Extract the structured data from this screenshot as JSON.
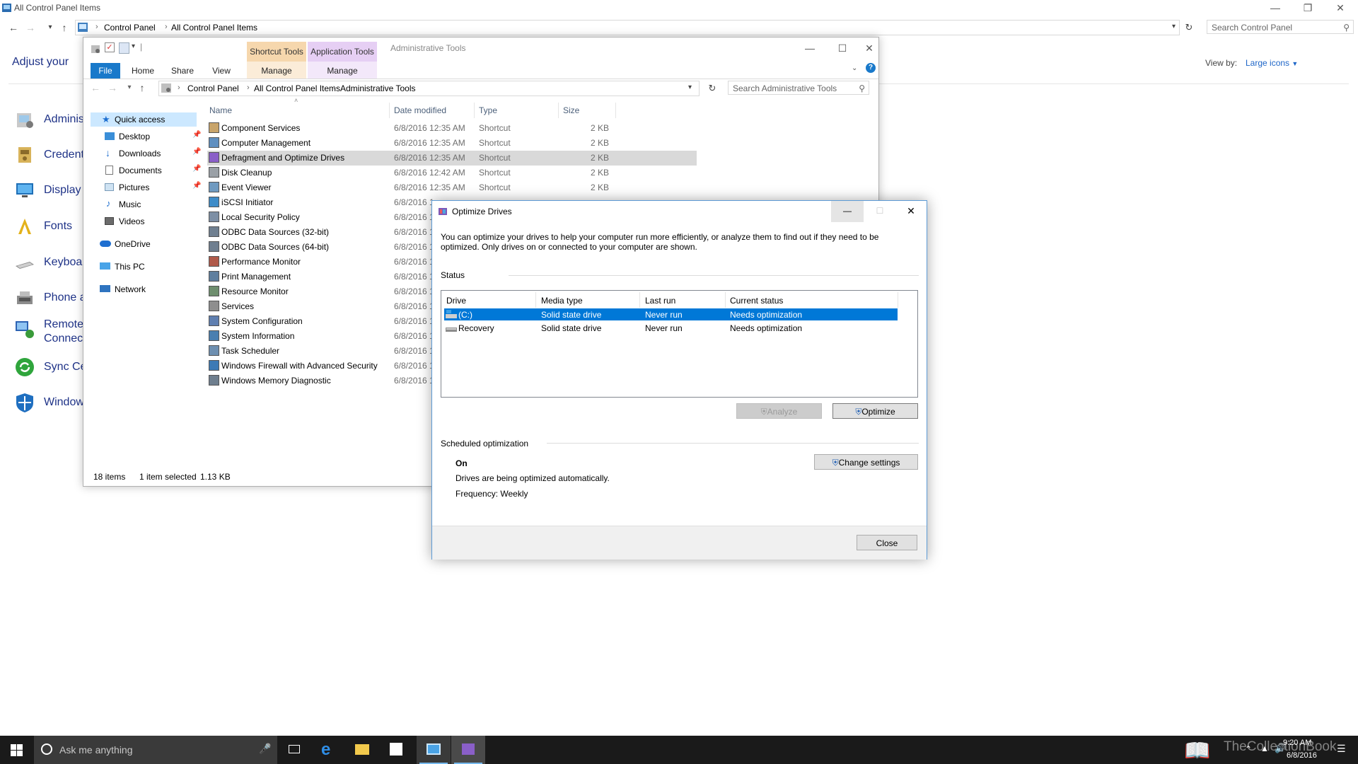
{
  "control_panel": {
    "title": "All Control Panel Items",
    "breadcrumb": [
      "Control Panel",
      "All Control Panel Items"
    ],
    "search_placeholder": "Search Control Panel",
    "adjust_text": "Adjust your co",
    "view_by_label": "View by:",
    "view_by_value": "Large icons",
    "items": [
      {
        "label": "Adminis",
        "icon": "admin-tools-icon"
      },
      {
        "label": "Credent",
        "icon": "credential-manager-icon"
      },
      {
        "label": "Display",
        "icon": "display-icon"
      },
      {
        "label": "Fonts",
        "icon": "fonts-icon"
      },
      {
        "label": "Keyboar",
        "icon": "keyboard-icon"
      },
      {
        "label": "Phone a",
        "icon": "phone-modem-icon"
      },
      {
        "label": "Remote",
        "label2": "Connect",
        "icon": "remote-connections-icon"
      },
      {
        "label": "Sync Ce",
        "icon": "sync-center-icon"
      },
      {
        "label": "Window",
        "icon": "windows-defender-icon"
      }
    ]
  },
  "explorer": {
    "title": "Administrative Tools",
    "context_tabs": [
      {
        "head": "Shortcut Tools",
        "tab": "Manage",
        "color": "#f5d9b0"
      },
      {
        "head": "Application Tools",
        "tab": "Manage",
        "color": "#e3cbf0"
      }
    ],
    "ribbon_tabs": {
      "file": "File",
      "home": "Home",
      "share": "Share",
      "view": "View"
    },
    "breadcrumb": [
      "Control Panel",
      "All Control Panel Items",
      "Administrative Tools"
    ],
    "search_placeholder": "Search Administrative Tools",
    "nav": {
      "quick_access": "Quick access",
      "desktop": "Desktop",
      "downloads": "Downloads",
      "documents": "Documents",
      "pictures": "Pictures",
      "music": "Music",
      "videos": "Videos",
      "onedrive": "OneDrive",
      "this_pc": "This PC",
      "network": "Network"
    },
    "columns": {
      "name": "Name",
      "date": "Date modified",
      "type": "Type",
      "size": "Size"
    },
    "files": [
      {
        "name": "Component Services",
        "date": "6/8/2016 12:35 AM",
        "type": "Shortcut",
        "size": "2 KB"
      },
      {
        "name": "Computer Management",
        "date": "6/8/2016 12:35 AM",
        "type": "Shortcut",
        "size": "2 KB"
      },
      {
        "name": "Defragment and Optimize Drives",
        "date": "6/8/2016 12:35 AM",
        "type": "Shortcut",
        "size": "2 KB"
      },
      {
        "name": "Disk Cleanup",
        "date": "6/8/2016 12:42 AM",
        "type": "Shortcut",
        "size": "2 KB"
      },
      {
        "name": "Event Viewer",
        "date": "6/8/2016 12:35 AM",
        "type": "Shortcut",
        "size": "2 KB"
      },
      {
        "name": "iSCSI Initiator",
        "date": "6/8/2016 1",
        "type": "",
        "size": ""
      },
      {
        "name": "Local Security Policy",
        "date": "6/8/2016 1",
        "type": "",
        "size": ""
      },
      {
        "name": "ODBC Data Sources (32-bit)",
        "date": "6/8/2016 1",
        "type": "",
        "size": ""
      },
      {
        "name": "ODBC Data Sources (64-bit)",
        "date": "6/8/2016 1",
        "type": "",
        "size": ""
      },
      {
        "name": "Performance Monitor",
        "date": "6/8/2016 1",
        "type": "",
        "size": ""
      },
      {
        "name": "Print Management",
        "date": "6/8/2016 1",
        "type": "",
        "size": ""
      },
      {
        "name": "Resource Monitor",
        "date": "6/8/2016 1",
        "type": "",
        "size": ""
      },
      {
        "name": "Services",
        "date": "6/8/2016 1",
        "type": "",
        "size": ""
      },
      {
        "name": "System Configuration",
        "date": "6/8/2016 1",
        "type": "",
        "size": ""
      },
      {
        "name": "System Information",
        "date": "6/8/2016 1",
        "type": "",
        "size": ""
      },
      {
        "name": "Task Scheduler",
        "date": "6/8/2016 1",
        "type": "",
        "size": ""
      },
      {
        "name": "Windows Firewall with Advanced Security",
        "date": "6/8/2016 1",
        "type": "",
        "size": ""
      },
      {
        "name": "Windows Memory Diagnostic",
        "date": "6/8/2016 1",
        "type": "",
        "size": ""
      }
    ],
    "selected_index": 2,
    "status": {
      "count": "18 items",
      "selection": "1 item selected",
      "size": "1.13 KB"
    }
  },
  "dialog": {
    "title": "Optimize Drives",
    "description": "You can optimize your drives to help your computer run more efficiently, or analyze them to find out if they need to be optimized. Only drives on or connected to your computer are shown.",
    "status_label": "Status",
    "columns": {
      "drive": "Drive",
      "media": "Media type",
      "last_run": "Last run",
      "status": "Current status"
    },
    "drives": [
      {
        "drive": "(C:)",
        "media": "Solid state drive",
        "last_run": "Never run",
        "status": "Needs optimization"
      },
      {
        "drive": "Recovery",
        "media": "Solid state drive",
        "last_run": "Never run",
        "status": "Needs optimization"
      }
    ],
    "analyze_label": "Analyze",
    "optimize_label": "Optimize",
    "scheduled_label": "Scheduled optimization",
    "schedule_state": "On",
    "schedule_desc": "Drives are being optimized automatically.",
    "frequency": "Frequency: Weekly",
    "change_settings_label": "Change settings",
    "close_label": "Close"
  },
  "taskbar": {
    "search_placeholder": "Ask me anything",
    "time": "9:20 AM",
    "date": "6/8/2016",
    "watermark": "TheCollectionBook"
  }
}
